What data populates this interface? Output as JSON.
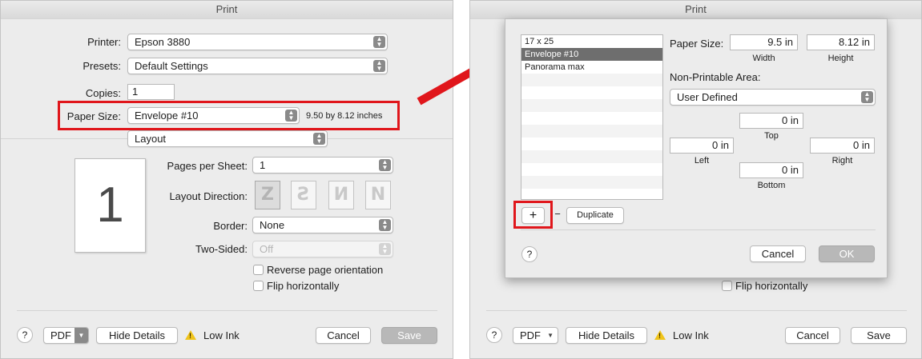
{
  "left": {
    "title": "Print",
    "printer_label": "Printer:",
    "printer_value": "Epson 3880",
    "presets_label": "Presets:",
    "presets_value": "Default Settings",
    "copies_label": "Copies:",
    "copies_value": "1",
    "paper_size_label": "Paper Size:",
    "paper_size_value": "Envelope #10",
    "paper_size_dims": "9.50 by 8.12 inches",
    "section_value": "Layout",
    "preview_page_number": "1",
    "pages_per_sheet_label": "Pages per Sheet:",
    "pages_per_sheet_value": "1",
    "layout_direction_label": "Layout Direction:",
    "border_label": "Border:",
    "border_value": "None",
    "two_sided_label": "Two-Sided:",
    "two_sided_value": "Off",
    "reverse_label": "Reverse page orientation",
    "flip_label": "Flip horizontally",
    "help": "?",
    "pdf": "PDF",
    "hide_details": "Hide Details",
    "low_ink": "Low Ink",
    "cancel": "Cancel",
    "save": "Save"
  },
  "right": {
    "title": "Print",
    "paper_list": [
      "17 x 25",
      "Envelope #10",
      "Panorama max"
    ],
    "selected_index": 1,
    "paper_size_label": "Paper Size:",
    "width_value": "9.5 in",
    "height_value": "8.12 in",
    "width_caption": "Width",
    "height_caption": "Height",
    "non_printable_label": "Non-Printable Area:",
    "non_printable_value": "User Defined",
    "top_value": "0 in",
    "top_caption": "Top",
    "left_value": "0 in",
    "left_caption": "Left",
    "right_value": "0 in",
    "right_caption": "Right",
    "bottom_value": "0 in",
    "bottom_caption": "Bottom",
    "add_symbol": "+",
    "remove_symbol": "−",
    "duplicate": "Duplicate",
    "help": "?",
    "cancel": "Cancel",
    "ok": "OK",
    "flip_label": "Flip horizontally",
    "pdf": "PDF",
    "hide_details": "Hide Details",
    "low_ink": "Low Ink",
    "footer_cancel": "Cancel",
    "footer_save": "Save"
  },
  "colors": {
    "highlight_red": "#e0161b",
    "selection": "#6e6e6e"
  },
  "icons": {
    "dropdown": "chevron-updown-icon",
    "warning": "warning-triangle-icon",
    "arrow": "red-arrow-icon"
  }
}
